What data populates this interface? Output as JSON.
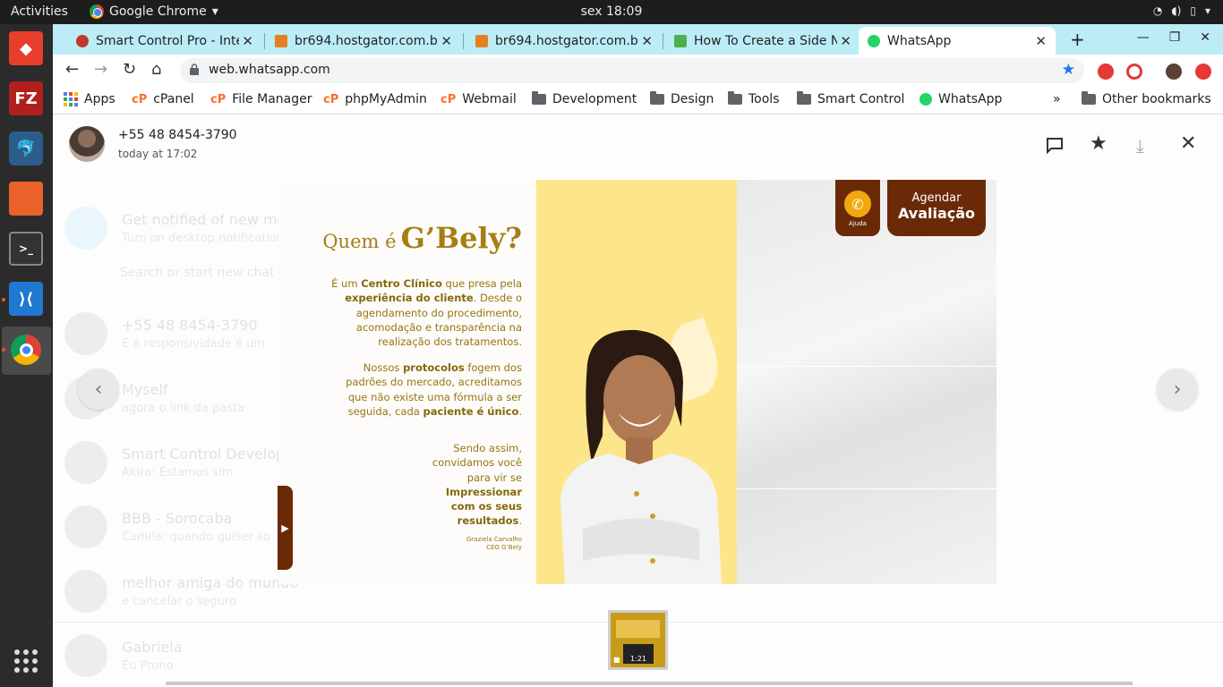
{
  "topbar": {
    "activities": "Activities",
    "app_name": "Google Chrome",
    "clock": "sex 18:09"
  },
  "tabs": [
    {
      "title": "Smart Control Pro - Inte",
      "favicon_color": "#c0392b",
      "active": false
    },
    {
      "title": "br694.hostgator.com.b",
      "favicon_color": "#e67e22",
      "active": false
    },
    {
      "title": "br694.hostgator.com.b",
      "favicon_color": "#e67e22",
      "active": false
    },
    {
      "title": "How To Create a Side N",
      "favicon_color": "#4caf50",
      "active": false
    },
    {
      "title": "WhatsApp",
      "favicon_color": "#25d366",
      "active": true
    }
  ],
  "toolbar": {
    "url": "web.whatsapp.com"
  },
  "bookmarks": [
    {
      "label": "Apps",
      "icon": "apps-grid-icon"
    },
    {
      "label": "cPanel",
      "icon": "cpanel-icon"
    },
    {
      "label": "File Manager",
      "icon": "cpanel-icon"
    },
    {
      "label": "phpMyAdmin",
      "icon": "cpanel-icon"
    },
    {
      "label": "Webmail",
      "icon": "cpanel-icon"
    },
    {
      "label": "Development",
      "icon": "folder-icon"
    },
    {
      "label": "Design",
      "icon": "folder-icon"
    },
    {
      "label": "Tools",
      "icon": "folder-icon"
    },
    {
      "label": "Smart Control",
      "icon": "folder-icon"
    },
    {
      "label": "WhatsApp",
      "icon": "whatsapp-icon"
    }
  ],
  "other_bookmarks": "Other bookmarks",
  "viewer": {
    "contact": "+55 48 8454-3790",
    "time": "today at 17:02"
  },
  "media": {
    "title_q": "Quem é",
    "title_g": "G’Bely?",
    "p1_a": "É um",
    "p1_b": "Centro Clínico",
    "p1_c": "que presa pela",
    "p1_d": "experiência do cliente",
    "p1_e": ". Desde o agendamento do procedimento, acomodação e transparência na realização dos tratamentos.",
    "p2_a": "Nossos",
    "p2_b": "protocolos",
    "p2_c": "fogem dos padrões do mercado, acreditamos que não existe uma fórmula a ser seguida, cada",
    "p2_d": "paciente é único",
    "p2_e": ".",
    "p3_a": "Sendo assim, convidamos você para vir se",
    "p3_b": "Impressionar com os seus resultados",
    "p3_c": ".",
    "sig_name": "Graziela Carvalho",
    "sig_role": "CEO G’Bely",
    "call_label": "Ajuda",
    "agendar_1": "Agendar",
    "agendar_2": "Avaliação"
  },
  "thumbnail": {
    "duration": "1:21"
  },
  "background_chats": [
    {
      "name": "Get notified of new messages",
      "msg": "Turn on desktop notifications"
    },
    {
      "name": "+55 48 8454-3790",
      "msg": "E a responsividade é um"
    },
    {
      "name": "Myself",
      "msg": "agora o link da pasta"
    },
    {
      "name": "Smart Control Developer",
      "msg": "Akira: Estamos sim"
    },
    {
      "name": "BBB - Sorocaba",
      "msg": "Camila: quando quiser so"
    },
    {
      "name": "melhor amiga do mundo",
      "msg": "e cancelar o seguro"
    },
    {
      "name": "Gabriela",
      "msg": "Eu Prono"
    }
  ],
  "search_placeholder": "Search or start new chat",
  "colors": {
    "tabstrip": "#bcedf6",
    "brand_gold": "#a57f16",
    "brand_brown": "#6b2a07",
    "promo_yellow": "#fde68a"
  }
}
